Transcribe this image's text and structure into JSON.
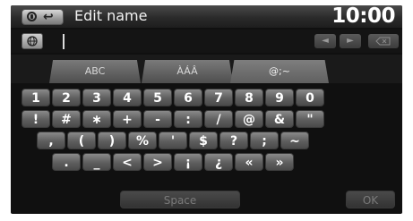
{
  "header": {
    "title": "Edit name",
    "clock": "10:00",
    "back_glyph": "↩"
  },
  "input": {
    "value": ""
  },
  "tabs": [
    {
      "label": "ABC"
    },
    {
      "label": "ÀÁÂ"
    },
    {
      "label": "@;~"
    }
  ],
  "keyboard": {
    "row1": [
      "1",
      "2",
      "3",
      "4",
      "5",
      "6",
      "7",
      "8",
      "9",
      "0"
    ],
    "row2": [
      "!",
      "#",
      "∗",
      "+",
      "-",
      ":",
      "/",
      "@",
      "&",
      "\""
    ],
    "row3": [
      ",",
      "(",
      ")",
      "%",
      "'",
      "$",
      "?",
      ";",
      "~"
    ],
    "row4": [
      ".",
      "_",
      "<",
      ">",
      "¡",
      "¿",
      "«",
      "»"
    ],
    "space_label": "Space",
    "ok_label": "OK"
  },
  "icons": {
    "home": "home-icon",
    "back": "back-icon",
    "globe": "globe-icon",
    "left": "left-arrow-icon",
    "right": "right-arrow-icon",
    "delete": "delete-icon"
  }
}
